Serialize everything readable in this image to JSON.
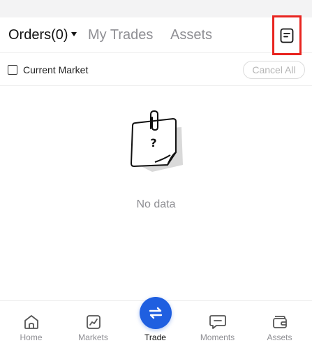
{
  "tabs": {
    "orders_label": "Orders(0)",
    "my_trades_label": "My Trades",
    "assets_label": "Assets"
  },
  "toolbar": {
    "history_icon": "order-history-icon",
    "highlight_color": "#e8241f"
  },
  "filter": {
    "current_market_label": "Current Market",
    "current_market_checked": false,
    "cancel_all_label": "Cancel All"
  },
  "empty_state": {
    "illustration": "document-question-icon",
    "message": "No data"
  },
  "bottom_nav": {
    "accent_color": "#1f5fe0",
    "items": [
      {
        "label": "Home",
        "icon": "home-icon",
        "active": false
      },
      {
        "label": "Markets",
        "icon": "chart-icon",
        "active": false
      },
      {
        "label": "Trade",
        "icon": "swap-arrows-icon",
        "active": true
      },
      {
        "label": "Moments",
        "icon": "chat-bubble-icon",
        "active": false
      },
      {
        "label": "Assets",
        "icon": "wallet-icon",
        "active": false
      }
    ]
  }
}
